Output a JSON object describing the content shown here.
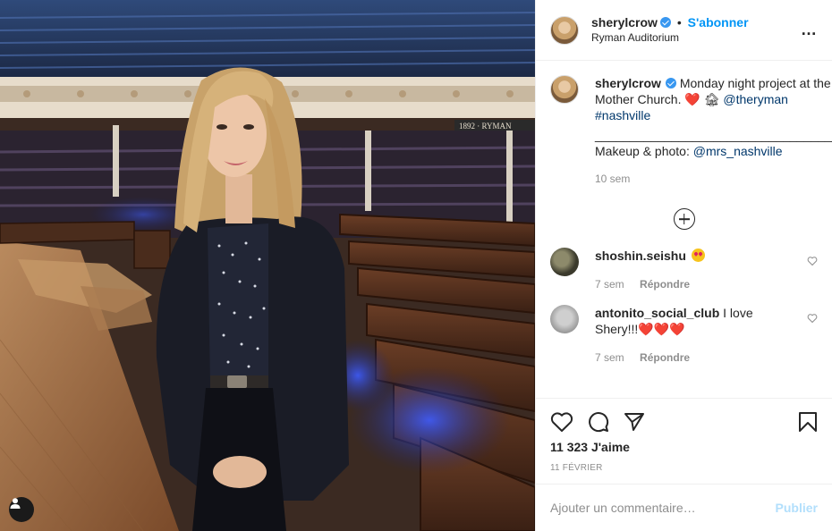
{
  "photo": {
    "theater_sign": "1892 · RYMAN",
    "user_tag_icon": "user-silhouette-icon"
  },
  "header": {
    "username": "sherylcrow",
    "separator": "•",
    "follow_label": "S'abonner",
    "location": "Ryman Auditorium",
    "more_icon": "…"
  },
  "caption": {
    "username": "sherylcrow",
    "text_1": "Monday night project at the Mother Church.",
    "emoji_heart": "❤️",
    "emoji_house": "🏚",
    "mention_1": "@theryman",
    "hashtag": "#nashville",
    "divider": "___________________________________",
    "text_2": "Makeup & photo:",
    "mention_2": "@mrs_nashville",
    "time": "10 sem"
  },
  "comments": [
    {
      "username": "shoshin.seishu",
      "text": "",
      "emoji": "😍",
      "time": "7 sem",
      "reply_label": "Répondre"
    },
    {
      "username": "antonito_social_club",
      "text": "I love Shery!!!",
      "emoji": "❤️❤️❤️",
      "time": "7 sem",
      "reply_label": "Répondre"
    }
  ],
  "stats": {
    "likes": "11 323 J'aime",
    "date": "11 FÉVRIER"
  },
  "add_comment": {
    "placeholder": "Ajouter un commentaire…",
    "publish_label": "Publier"
  },
  "colors": {
    "link": "#00376b",
    "follow": "#0095f6",
    "verified": "#3897f0",
    "heart": "#e0245e",
    "publish_disabled": "#b2dffc"
  }
}
